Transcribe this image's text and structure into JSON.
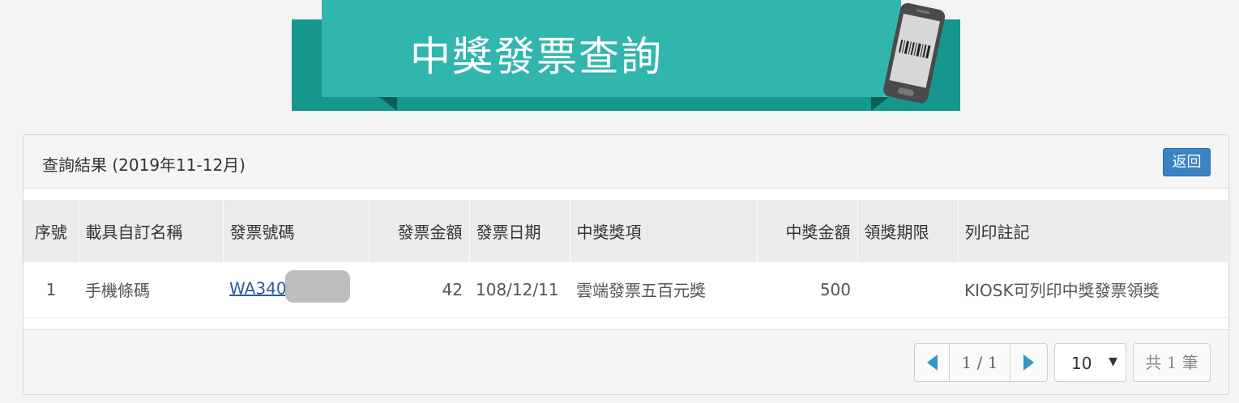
{
  "banner": {
    "title": "中獎發票查詢"
  },
  "panel": {
    "title": "查詢結果 (2019年11-12月)",
    "back_label": "返回"
  },
  "table": {
    "headers": [
      "序號",
      "載具自訂名稱",
      "發票號碼",
      "發票金額",
      "發票日期",
      "中獎獎項",
      "中獎金額",
      "領獎期限",
      "列印註記"
    ],
    "rows": [
      {
        "no": "1",
        "carrier_name": "手機條碼",
        "invoice_no": "WA340",
        "amount": "42",
        "date": "108/12/11",
        "prize": "雲端發票五百元獎",
        "prize_amount": "500",
        "deadline": "",
        "note": "KIOSK可列印中獎發票領獎"
      }
    ]
  },
  "pager": {
    "current": "1 / 1",
    "page_size": "10",
    "total": "共 1 筆"
  },
  "colors": {
    "teal": "#31b6ad",
    "teal_dark": "#16978d",
    "link": "#2a5c97",
    "button": "#3a83c5"
  }
}
